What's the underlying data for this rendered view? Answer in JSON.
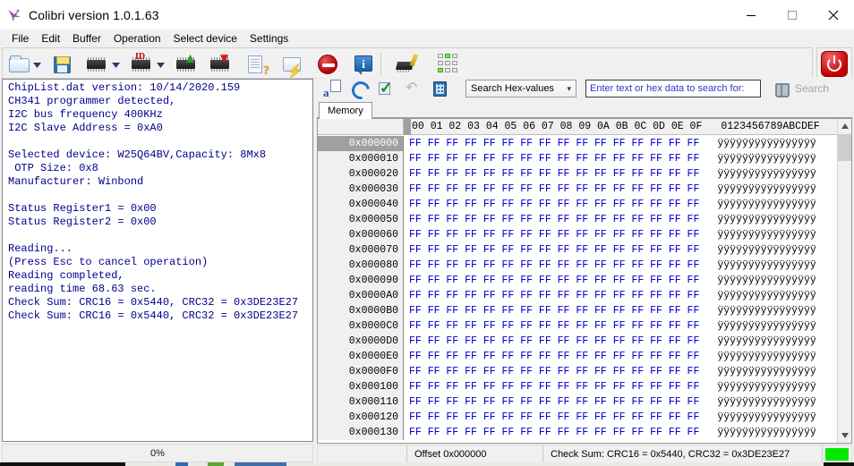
{
  "window": {
    "title": "Colibri version 1.0.1.63",
    "app_icon": "colibri-hummingbird-icon",
    "minimize_label": "—",
    "maximize_label": "□",
    "close_label": "✕"
  },
  "menu": {
    "items": [
      {
        "label": "File"
      },
      {
        "label": "Edit"
      },
      {
        "label": "Buffer"
      },
      {
        "label": "Operation"
      },
      {
        "label": "Select device"
      },
      {
        "label": "Settings"
      }
    ]
  },
  "toolbar": {
    "buttons": [
      {
        "name": "open-file-button",
        "icon": "open-folder-icon"
      },
      {
        "name": "open-file-dropdown",
        "icon": "chevron-down-icon"
      },
      {
        "name": "save-file-button",
        "icon": "floppy-disk-icon"
      },
      {
        "name": "read-chip-button",
        "icon": "chip-icon"
      },
      {
        "name": "read-chip-dropdown",
        "icon": "chevron-down-icon"
      },
      {
        "name": "chip-id-button",
        "icon": "chip-id-icon",
        "badge": "ID"
      },
      {
        "name": "chip-id-dropdown",
        "icon": "chevron-down-icon"
      },
      {
        "name": "read-from-chip-button",
        "icon": "chip-arrow-up-icon"
      },
      {
        "name": "write-to-chip-button",
        "icon": "chip-arrow-down-icon"
      },
      {
        "name": "verify-button",
        "icon": "document-question-icon"
      },
      {
        "name": "script-button",
        "icon": "scroll-lightning-icon"
      },
      {
        "name": "stop-button",
        "icon": "stop-sign-icon"
      },
      {
        "name": "info-button",
        "icon": "info-balloon-icon"
      },
      {
        "name": "erase-chip-button",
        "icon": "chip-brush-icon"
      },
      {
        "name": "pin-detect-button",
        "icon": "pin-grid-icon"
      }
    ],
    "power_button": {
      "name": "power-button",
      "icon": "power-icon"
    }
  },
  "log": {
    "text": "ChipList.dat version: 10/14/2020.159\nCH341 programmer detected,\nI2C bus frequency 400KHz\nI2C Slave Address = 0xA0\n\nSelected device: W25Q64BV,Capacity: 8Mx8\n OTP Size: 0x8\nManufacturer: Winbond\n\nStatus Register1 = 0x00\nStatus Register2 = 0x00\n\nReading...\n(Press Esc to cancel operation)\nReading completed,\nreading time 68.63 sec.\nCheck Sum: CRC16 = 0x5440, CRC32 = 0x3DE23E27\nCheck Sum: CRC16 = 0x5440, CRC32 = 0x3DE23E27\n"
  },
  "progress": {
    "label": "0%",
    "value": 0
  },
  "hex_toolbar": {
    "buttons": [
      {
        "name": "insert-data-button",
        "icon": "insert-text-page-icon"
      },
      {
        "name": "refresh-button",
        "icon": "refresh-arrows-icon"
      },
      {
        "name": "apply-check-button",
        "icon": "checkmark-page-icon"
      },
      {
        "name": "undo-button",
        "icon": "undo-arrow-icon"
      },
      {
        "name": "calculator-button",
        "icon": "calculator-icon"
      }
    ],
    "search_mode": "Search Hex-values",
    "search_mode_chevron": "▼",
    "search_placeholder": "Enter text or hex data to search for:",
    "search_value": "",
    "search_button_label": "Search",
    "search_button_icon": "binoculars-icon"
  },
  "tabs": [
    {
      "label": "Memory",
      "active": true
    }
  ],
  "hex_view": {
    "column_headers": "00 01 02 03 04 05 06 07 08 09 0A 0B 0C 0D 0E 0F",
    "ascii_header": "0123456789ABCDEF",
    "selected_row_index": 0,
    "rows": [
      {
        "address": "0x000000",
        "hex": "FF FF FF FF FF FF FF FF FF FF FF FF FF FF FF FF",
        "ascii": "ÿÿÿÿÿÿÿÿÿÿÿÿÿÿÿÿ"
      },
      {
        "address": "0x000010",
        "hex": "FF FF FF FF FF FF FF FF FF FF FF FF FF FF FF FF",
        "ascii": "ÿÿÿÿÿÿÿÿÿÿÿÿÿÿÿÿ"
      },
      {
        "address": "0x000020",
        "hex": "FF FF FF FF FF FF FF FF FF FF FF FF FF FF FF FF",
        "ascii": "ÿÿÿÿÿÿÿÿÿÿÿÿÿÿÿÿ"
      },
      {
        "address": "0x000030",
        "hex": "FF FF FF FF FF FF FF FF FF FF FF FF FF FF FF FF",
        "ascii": "ÿÿÿÿÿÿÿÿÿÿÿÿÿÿÿÿ"
      },
      {
        "address": "0x000040",
        "hex": "FF FF FF FF FF FF FF FF FF FF FF FF FF FF FF FF",
        "ascii": "ÿÿÿÿÿÿÿÿÿÿÿÿÿÿÿÿ"
      },
      {
        "address": "0x000050",
        "hex": "FF FF FF FF FF FF FF FF FF FF FF FF FF FF FF FF",
        "ascii": "ÿÿÿÿÿÿÿÿÿÿÿÿÿÿÿÿ"
      },
      {
        "address": "0x000060",
        "hex": "FF FF FF FF FF FF FF FF FF FF FF FF FF FF FF FF",
        "ascii": "ÿÿÿÿÿÿÿÿÿÿÿÿÿÿÿÿ"
      },
      {
        "address": "0x000070",
        "hex": "FF FF FF FF FF FF FF FF FF FF FF FF FF FF FF FF",
        "ascii": "ÿÿÿÿÿÿÿÿÿÿÿÿÿÿÿÿ"
      },
      {
        "address": "0x000080",
        "hex": "FF FF FF FF FF FF FF FF FF FF FF FF FF FF FF FF",
        "ascii": "ÿÿÿÿÿÿÿÿÿÿÿÿÿÿÿÿ"
      },
      {
        "address": "0x000090",
        "hex": "FF FF FF FF FF FF FF FF FF FF FF FF FF FF FF FF",
        "ascii": "ÿÿÿÿÿÿÿÿÿÿÿÿÿÿÿÿ"
      },
      {
        "address": "0x0000A0",
        "hex": "FF FF FF FF FF FF FF FF FF FF FF FF FF FF FF FF",
        "ascii": "ÿÿÿÿÿÿÿÿÿÿÿÿÿÿÿÿ"
      },
      {
        "address": "0x0000B0",
        "hex": "FF FF FF FF FF FF FF FF FF FF FF FF FF FF FF FF",
        "ascii": "ÿÿÿÿÿÿÿÿÿÿÿÿÿÿÿÿ"
      },
      {
        "address": "0x0000C0",
        "hex": "FF FF FF FF FF FF FF FF FF FF FF FF FF FF FF FF",
        "ascii": "ÿÿÿÿÿÿÿÿÿÿÿÿÿÿÿÿ"
      },
      {
        "address": "0x0000D0",
        "hex": "FF FF FF FF FF FF FF FF FF FF FF FF FF FF FF FF",
        "ascii": "ÿÿÿÿÿÿÿÿÿÿÿÿÿÿÿÿ"
      },
      {
        "address": "0x0000E0",
        "hex": "FF FF FF FF FF FF FF FF FF FF FF FF FF FF FF FF",
        "ascii": "ÿÿÿÿÿÿÿÿÿÿÿÿÿÿÿÿ"
      },
      {
        "address": "0x0000F0",
        "hex": "FF FF FF FF FF FF FF FF FF FF FF FF FF FF FF FF",
        "ascii": "ÿÿÿÿÿÿÿÿÿÿÿÿÿÿÿÿ"
      },
      {
        "address": "0x000100",
        "hex": "FF FF FF FF FF FF FF FF FF FF FF FF FF FF FF FF",
        "ascii": "ÿÿÿÿÿÿÿÿÿÿÿÿÿÿÿÿ"
      },
      {
        "address": "0x000110",
        "hex": "FF FF FF FF FF FF FF FF FF FF FF FF FF FF FF FF",
        "ascii": "ÿÿÿÿÿÿÿÿÿÿÿÿÿÿÿÿ"
      },
      {
        "address": "0x000120",
        "hex": "FF FF FF FF FF FF FF FF FF FF FF FF FF FF FF FF",
        "ascii": "ÿÿÿÿÿÿÿÿÿÿÿÿÿÿÿÿ"
      },
      {
        "address": "0x000130",
        "hex": "FF FF FF FF FF FF FF FF FF FF FF FF FF FF FF FF",
        "ascii": "ÿÿÿÿÿÿÿÿÿÿÿÿÿÿÿÿ"
      }
    ],
    "scroll_up_glyph": "▲",
    "scroll_down_glyph": "▼"
  },
  "status_bar": {
    "cell1": "",
    "cell2": "",
    "offset": "Offset 0x000000",
    "checksum": "Check Sum: CRC16 = 0x5440, CRC32 = 0x3DE23E27",
    "led_color": "#00e800"
  }
}
